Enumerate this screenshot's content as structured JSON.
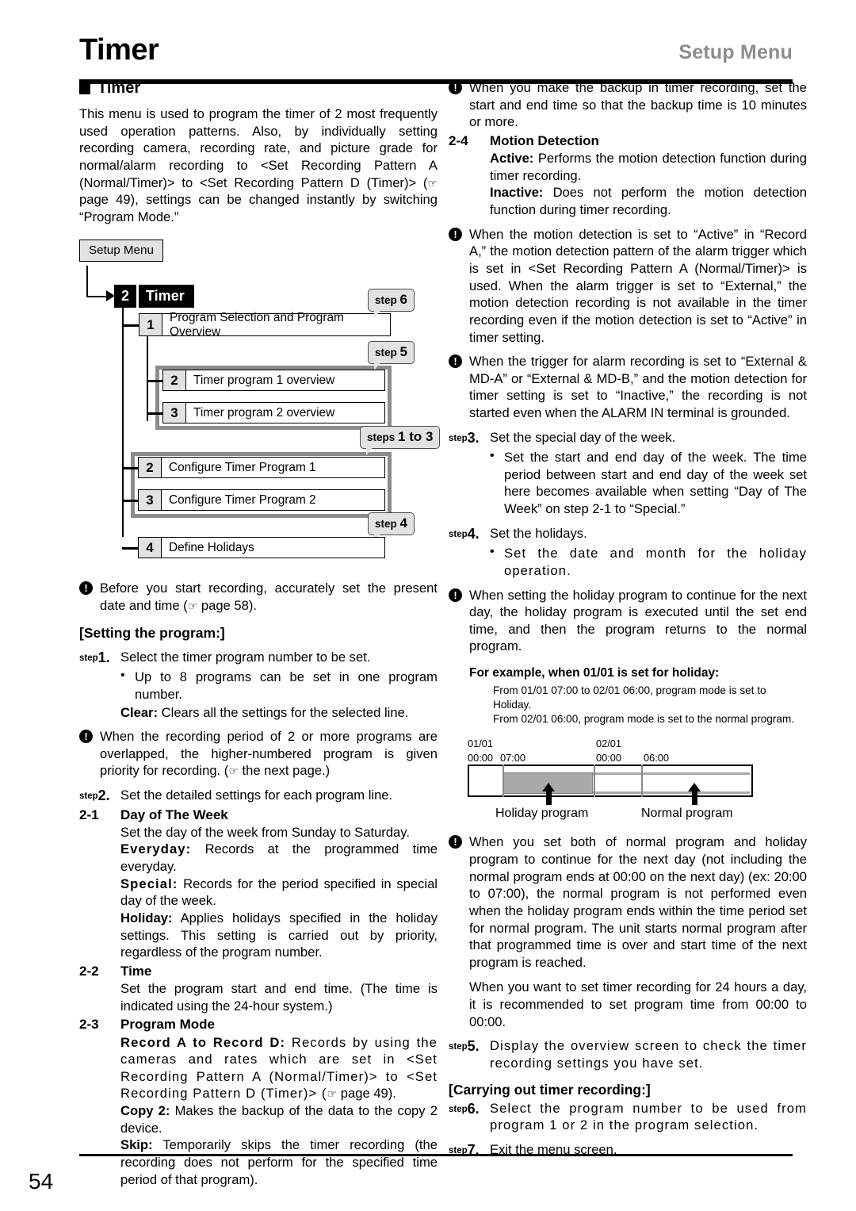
{
  "header": {
    "title": "Timer",
    "right_label": "Setup Menu"
  },
  "footer": {
    "page_number": "54"
  },
  "section": {
    "heading": "Timer",
    "intro": "This menu is used to program the timer of 2 most frequently used operation patterns. Also, by individually setting recording camera, recording rate, and picture grade for normal/alarm recording to <Set Recording Pattern A (Normal/Timer)> to <Set Recording Pattern D (Timer)> (",
    "intro_tail": " page 49), settings can be changed instantly by switching “Program Mode.”"
  },
  "flow": {
    "root_label": "Setup Menu",
    "timer_num": "2",
    "timer_label": "Timer",
    "rows": [
      {
        "num": "1",
        "label": "Program Selection and Program Overview"
      },
      {
        "num": "2",
        "label": "Timer program 1 overview"
      },
      {
        "num": "3",
        "label": "Timer program 2 overview"
      },
      {
        "num": "2",
        "label": "Configure Timer Program 1"
      },
      {
        "num": "3",
        "label": "Configure Timer Program 2"
      },
      {
        "num": "4",
        "label": "Define Holidays"
      }
    ],
    "callouts": {
      "step6_word": "step",
      "step6_num": "6",
      "step5_word": "step",
      "step5_num": "5",
      "steps13_word": "steps",
      "steps13_num": "1 to 3",
      "step4_word": "step",
      "step4_num": "4"
    }
  },
  "left": {
    "note_date": {
      "text": "Before you start recording, accurately set the present date and time (",
      "tail": " page 58)."
    },
    "setting_heading": "[Setting the program:]",
    "step1": {
      "word": "step",
      "num": "1.",
      "text": "Select the timer program number to be set.",
      "bullet": "Up to 8 programs can be set in one program number.",
      "clear_label": "Clear:",
      "clear_text": " Clears all the settings for the selected line."
    },
    "note_overlap": "When the recording period of 2 or more programs are overlapped, the higher-numbered program is given priority for recording. (",
    "note_overlap_tail": " the next page.)",
    "step2": {
      "word": "step",
      "num": "2.",
      "text": "Set the detailed settings for each program line."
    },
    "item_2_1": {
      "num": "2-1",
      "title": "Day of The Week",
      "line1": "Set the day of the week from Sunday to Saturday.",
      "everyday_label": "Everyday:",
      "everyday_text": " Records at the programmed time everyday.",
      "special_label": "Special:",
      "special_text": " Records for the period specified in special day of the week.",
      "holiday_label": "Holiday:",
      "holiday_text": " Applies holidays specified in the holiday settings. This setting is carried out by priority, regardless of the program number."
    },
    "item_2_2": {
      "num": "2-2",
      "title": "Time",
      "text": "Set the program start and end time. (The time is indicated using the 24-hour system.)"
    },
    "item_2_3": {
      "num": "2-3",
      "title": "Program Mode",
      "record_label": "Record A to Record D:",
      "record_text": " Records by using the cameras and rates which are set in <Set Recording Pattern A (Normal/Timer)> to <Set Recording Pattern D (Timer)> (",
      "record_tail": " page 49).",
      "copy_label": "Copy 2:",
      "copy_text": " Makes the backup of the data to the copy 2 device.",
      "skip_label": "Skip:",
      "skip_text": " Temporarily skips the timer recording (the recording does not perform for the specified time period of that program)."
    }
  },
  "right": {
    "note_backup": "When you make the backup in timer recording, set the start and end time so that the backup time is 10 minutes or more.",
    "item_2_4": {
      "num": "2-4",
      "title": "Motion Detection",
      "active_label": "Active:",
      "active_text": " Performs the motion detection function during timer recording.",
      "inactive_label": "Inactive:",
      "inactive_text": " Does not perform the motion detection function during timer recording."
    },
    "note_md": "When the motion detection is set to “Active” in “Record A,” the motion detection pattern of the alarm trigger which is set in <Set Recording Pattern A (Normal/Timer)> is used. When the alarm trigger is set to “External,” the motion detection recording is not available in the timer recording even if the motion detection is set to “Active” in timer setting.",
    "note_trigger": "When the trigger for alarm recording is set to “External & MD-A” or “External & MD-B,” and the motion detection for timer setting is set to “Inactive,” the recording is not started even when the ALARM IN terminal is grounded.",
    "step3": {
      "word": "step",
      "num": "3.",
      "text": "Set the special day of the week.",
      "bullet": "Set the start and end day of the week. The time period between start and end day of the week set here becomes available when setting “Day of The Week” on step 2-1 to “Special.”"
    },
    "step4": {
      "word": "step",
      "num": "4.",
      "text": "Set the holidays.",
      "bullet": "Set the date and month for the holiday operation."
    },
    "note_holiday": "When setting the holiday program to continue for the next day, the holiday program is executed until the set end time, and then the program returns to the normal program.",
    "example_heading": "For example, when 01/01 is set for holiday:",
    "example_line1": "From 01/01 07:00 to 02/01 06:00, program mode is set to Holiday.",
    "example_line2": "From 02/01 06:00, program mode is set to the normal program.",
    "note_both": "When you set both of normal program and holiday program to continue for the next day (not including the normal program ends at 00:00 on the next day) (ex: 20:00 to 07:00), the normal program is not performed even when the holiday program ends within the time period set for normal program. The unit starts normal program after that programmed time is over and start time of the next program is reached.",
    "note_24h": "When you want to set timer recording for 24 hours a day, it is recommended to set program time from 00:00 to 00:00.",
    "step5": {
      "word": "step",
      "num": "5.",
      "text": "Display the overview screen to check the timer recording settings you have set."
    },
    "carrying_heading": "[Carrying out timer recording:]",
    "step6": {
      "word": "step",
      "num": "6.",
      "text": "Select the program number to be used from program 1 or 2 in the program selection."
    },
    "step7": {
      "word": "step",
      "num": "7.",
      "text": "Exit the menu screen."
    }
  },
  "timeline": {
    "date_left": "01/01",
    "date_mid": "02/01",
    "time_0000_a": "00:00",
    "time_0700": "07:00",
    "time_0000_b": "00:00",
    "time_0600": "06:00",
    "label_holiday": "Holiday program",
    "label_normal": "Normal program"
  }
}
